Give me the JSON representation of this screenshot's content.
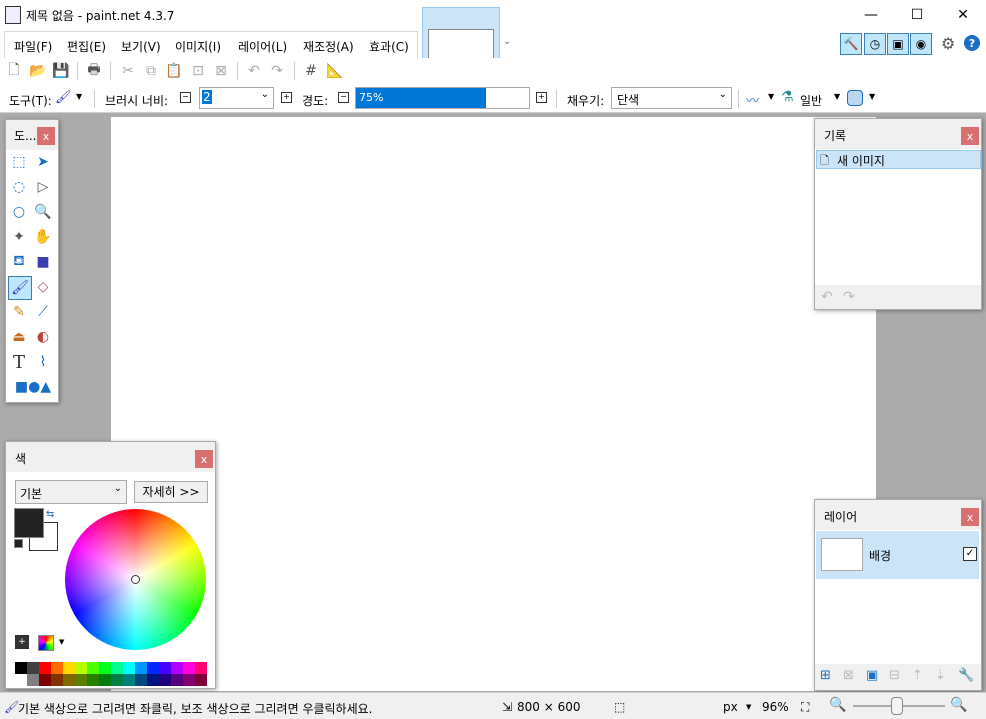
{
  "window": {
    "title": "제목 없음 - paint.net 4.3.7",
    "minimize": "—",
    "maximize": "☐",
    "close": "✕"
  },
  "menu": [
    {
      "label": "파일(F)"
    },
    {
      "label": "편집(E)"
    },
    {
      "label": "보기(V)"
    },
    {
      "label": "이미지(I)"
    },
    {
      "label": "레이어(L)"
    },
    {
      "label": "재조정(A)"
    },
    {
      "label": "효과(C)"
    }
  ],
  "toolbar2": {
    "tool_label": "도구(T):",
    "brush_width_label": "브러시 너비:",
    "brush_width_value": "2",
    "hardness_label": "경도:",
    "hardness_value": "75%",
    "hardness_fraction": 0.75,
    "fill_label": "채우기:",
    "fill_value": "단색",
    "blend_value": "일반"
  },
  "tools_panel": {
    "title": "도...",
    "close": "x"
  },
  "history_panel": {
    "title": "기록",
    "close": "x",
    "items": [
      {
        "label": "새 이미지"
      }
    ]
  },
  "layers_panel": {
    "title": "레이어",
    "close": "x",
    "layers": [
      {
        "label": "배경"
      }
    ]
  },
  "colors_panel": {
    "title": "색",
    "close": "x",
    "palette_select": "기본",
    "more_button": "자세히 >>"
  },
  "status": {
    "hint": "기본 색상으로 그리려면 좌클릭, 보조 색상으로 그리려면 우클릭하세요.",
    "size": "800 × 600",
    "unit": "px",
    "zoom": "96%"
  },
  "colors": {
    "accent": "#0078d7",
    "close": "#d9706f",
    "primary_color": "#222222",
    "secondary_color": "#ffffff",
    "palette_top": [
      "#000000",
      "#404040",
      "#ff0000",
      "#ff6a00",
      "#ffd800",
      "#b6ff00",
      "#4cff00",
      "#00ff21",
      "#00ff90",
      "#00ffff",
      "#0094ff",
      "#0026ff",
      "#4800ff",
      "#b200ff",
      "#ff00dc",
      "#ff006e"
    ],
    "palette_bottom": [
      "#ffffff",
      "#808080",
      "#7f0000",
      "#7f3300",
      "#7f6a00",
      "#5b7f00",
      "#267f00",
      "#007f0e",
      "#007f46",
      "#007f7f",
      "#004a7f",
      "#00137f",
      "#21007f",
      "#57007f",
      "#7f006e",
      "#7f0037"
    ]
  }
}
